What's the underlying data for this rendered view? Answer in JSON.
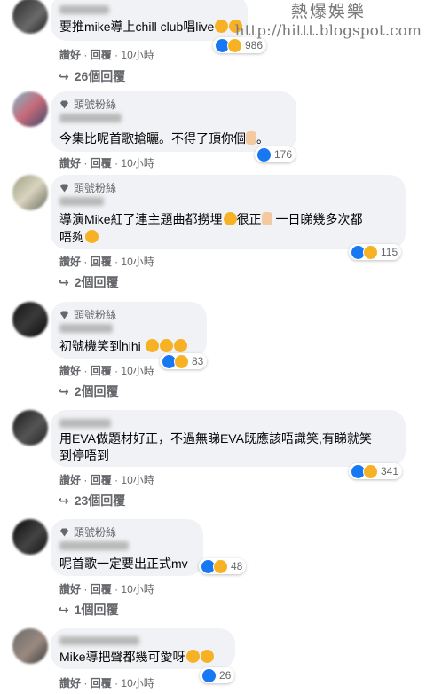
{
  "watermark": {
    "line1": "熱爆娛樂",
    "line2": "http://hittt.blogspot.com"
  },
  "actions": {
    "like": "讚好",
    "reply": "回覆",
    "sep": "·"
  },
  "comments": [
    {
      "badge": "",
      "text": [
        "要推mike導上chill club唱live"
      ],
      "time": "10小時",
      "reactions": "986",
      "replies": "26個回覆"
    },
    {
      "badge": "頭號粉絲",
      "text": [
        "今集比呢首歌搶曬。不得了頂你個"
      ],
      "time": "10小時",
      "reactions": "176",
      "replies": ""
    },
    {
      "badge": "頭號粉絲",
      "text": [
        "導演Mike紅了連主題曲都撈埋",
        "唔夠"
      ],
      "text_extra": [
        "很正",
        "一日睇幾多次都"
      ],
      "time": "10小時",
      "reactions": "115",
      "replies": "2個回覆"
    },
    {
      "badge": "頭號粉絲",
      "text": [
        "初號機笑到hihi"
      ],
      "time": "10小時",
      "reactions": "83",
      "replies": "2個回覆"
    },
    {
      "badge": "",
      "text": [
        "用EVA做題材好正，不過無睇EVA既應該唔識笑,有睇就笑",
        "到停唔到"
      ],
      "time": "10小時",
      "reactions": "341",
      "replies": "23個回覆"
    },
    {
      "badge": "頭號粉絲",
      "text": [
        "呢首歌一定要出正式mv"
      ],
      "time": "10小時",
      "reactions": "48",
      "replies": "1個回覆"
    },
    {
      "badge": "",
      "text": [
        "Mike導把聲都幾可愛呀"
      ],
      "time": "10小時",
      "reactions": "26",
      "replies": ""
    }
  ],
  "icons": {
    "reply_arrow": "reply-arrow-icon",
    "badge": "diamond-icon"
  }
}
